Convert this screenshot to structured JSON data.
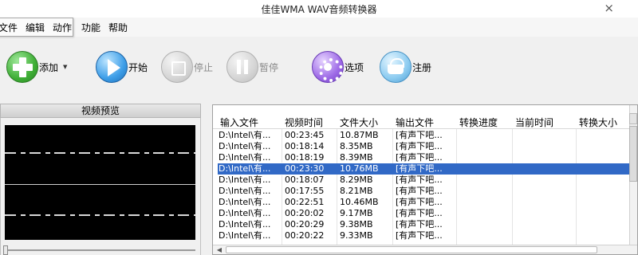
{
  "window": {
    "title": "佳佳WMA WAV音频转换器",
    "close_glyph": "×"
  },
  "menu": {
    "items": [
      {
        "label": "文件"
      },
      {
        "label": "编辑"
      },
      {
        "label": "动作"
      },
      {
        "label": "功能"
      },
      {
        "label": "帮助"
      }
    ]
  },
  "toolbar": {
    "add_label": "添加",
    "add_dropdown_glyph": "▼",
    "start_label": "开始",
    "stop_label": "停止",
    "pause_label": "暂停",
    "options_label": "选项",
    "register_label": "注册",
    "icons": {
      "add": "plus-circle-icon",
      "start": "play-circle-icon",
      "stop": "stop-circle-icon",
      "pause": "pause-circle-icon",
      "options": "gear-icon",
      "register": "basket-icon"
    }
  },
  "preview": {
    "title": "视频预览"
  },
  "file_list": {
    "columns": [
      "输入文件",
      "视频时间",
      "文件大小",
      "输出文件",
      "转换进度",
      "当前时间",
      "转换大小"
    ],
    "rows": [
      {
        "input": "D:\\Intel\\有...",
        "duration": "00:23:45",
        "size": "10.87MB",
        "output": "[有声下吧...",
        "selected": false
      },
      {
        "input": "D:\\Intel\\有...",
        "duration": "00:18:14",
        "size": "8.35MB",
        "output": "[有声下吧...",
        "selected": false
      },
      {
        "input": "D:\\Intel\\有...",
        "duration": "00:18:19",
        "size": "8.39MB",
        "output": "[有声下吧...",
        "selected": false
      },
      {
        "input": "D:\\Intel\\有...",
        "duration": "00:23:30",
        "size": "10.76MB",
        "output": "[有声下吧...",
        "selected": true
      },
      {
        "input": "D:\\Intel\\有...",
        "duration": "00:18:07",
        "size": "8.29MB",
        "output": "[有声下吧...",
        "selected": false
      },
      {
        "input": "D:\\Intel\\有...",
        "duration": "00:17:55",
        "size": "8.21MB",
        "output": "[有声下吧...",
        "selected": false
      },
      {
        "input": "D:\\Intel\\有...",
        "duration": "00:22:51",
        "size": "10.46MB",
        "output": "[有声下吧...",
        "selected": false
      },
      {
        "input": "D:\\Intel\\有...",
        "duration": "00:20:02",
        "size": "9.17MB",
        "output": "[有声下吧...",
        "selected": false
      },
      {
        "input": "D:\\Intel\\有...",
        "duration": "00:20:29",
        "size": "9.38MB",
        "output": "[有声下吧...",
        "selected": false
      },
      {
        "input": "D:\\Intel\\有...",
        "duration": "00:20:22",
        "size": "9.33MB",
        "output": "[有声下吧...",
        "selected": false
      }
    ]
  },
  "colors": {
    "selection": "#3169c6",
    "background": "#f0f0f0"
  }
}
